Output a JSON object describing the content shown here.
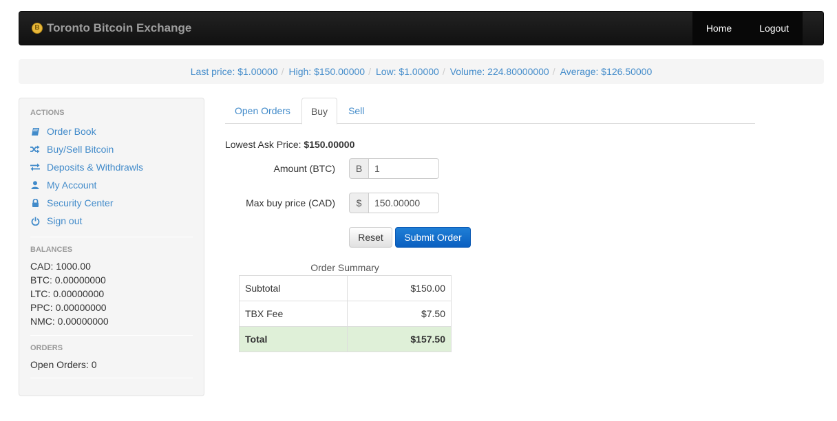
{
  "navbar": {
    "brand_icon": "bitcoin-coin-icon",
    "brand_icon_glyph": "B",
    "brand": "Toronto Bitcoin Exchange",
    "links": [
      "Home",
      "Logout"
    ]
  },
  "ticker": {
    "last_price": "Last price: $1.00000",
    "high": "High: $150.00000",
    "low": "Low: $1.00000",
    "volume": "Volume: 224.80000000",
    "average": "Average: $126.50000",
    "separator": "/"
  },
  "sidebar": {
    "actions_header": "ACTIONS",
    "actions": [
      {
        "label": "Order Book",
        "icon": "book-icon"
      },
      {
        "label": "Buy/Sell Bitcoin",
        "icon": "shuffle-icon"
      },
      {
        "label": "Deposits & Withdrawls",
        "icon": "transfer-icon"
      },
      {
        "label": "My Account",
        "icon": "user-icon"
      },
      {
        "label": "Security Center",
        "icon": "lock-icon"
      },
      {
        "label": "Sign out",
        "icon": "power-icon"
      }
    ],
    "balances_header": "BALANCES",
    "balances": [
      "CAD: 1000.00",
      "BTC: 0.00000000",
      "LTC: 0.00000000",
      "PPC: 0.00000000",
      "NMC: 0.00000000"
    ],
    "orders_header": "ORDERS",
    "open_orders": "Open Orders: 0"
  },
  "tabs": [
    "Open Orders",
    "Buy",
    "Sell"
  ],
  "active_tab": "Buy",
  "buy_form": {
    "lowest_ask_label": "Lowest Ask Price:",
    "lowest_ask_value": "$150.00000",
    "amount_label": "Amount (BTC)",
    "amount_addon": "B",
    "amount_value": "1",
    "max_price_label": "Max buy price (CAD)",
    "max_price_addon": "$",
    "max_price_value": "150.00000",
    "reset_label": "Reset",
    "submit_label": "Submit Order"
  },
  "order_summary": {
    "caption": "Order Summary",
    "rows": [
      {
        "label": "Subtotal",
        "value": "$150.00"
      },
      {
        "label": "TBX Fee",
        "value": "$7.50"
      },
      {
        "label": "Total",
        "value": "$157.50"
      }
    ]
  },
  "colors": {
    "link": "#428bca",
    "navbar": "#111111",
    "primary_button": "#0a5fc0",
    "total_row": "#dff0d8"
  }
}
